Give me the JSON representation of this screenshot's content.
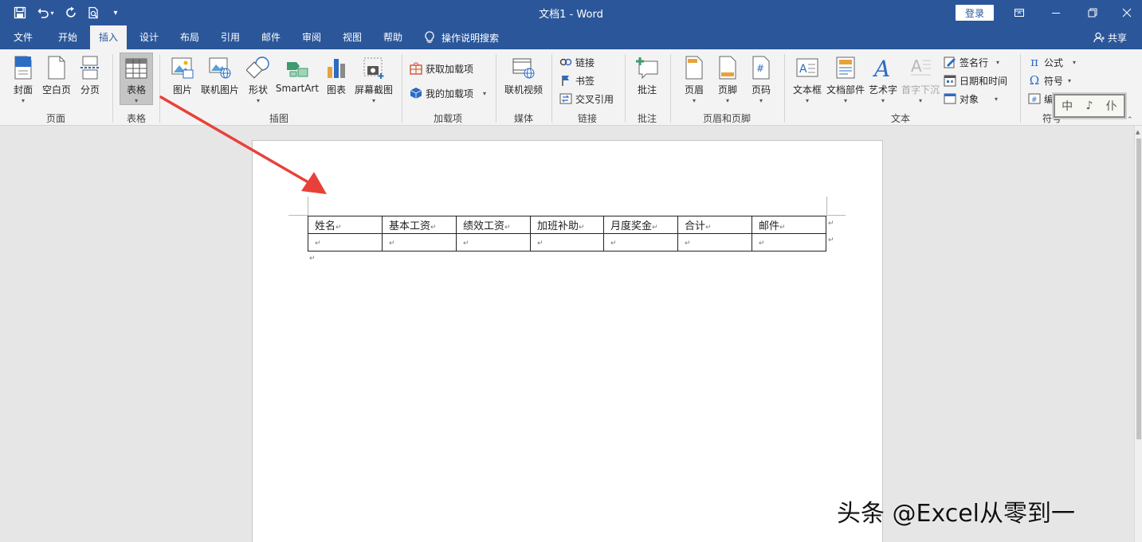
{
  "app": {
    "doc_title": "文档1",
    "separator": " - ",
    "app_name": "Word",
    "login_label": "登录"
  },
  "quick_access": {
    "save_icon": "save-icon",
    "undo_icon": "undo-icon",
    "redo_icon": "redo-icon",
    "print_preview_icon": "print-preview-icon",
    "customize_icon": "customize-icon"
  },
  "tabs": [
    "文件",
    "开始",
    "插入",
    "设计",
    "布局",
    "引用",
    "邮件",
    "审阅",
    "视图",
    "帮助"
  ],
  "active_tab": "插入",
  "tell_me": "操作说明搜索",
  "share_label": "共享",
  "ribbon": {
    "groups": {
      "pages": "页面",
      "tables": "表格",
      "illustrations": "插图",
      "addins": "加载项",
      "media": "媒体",
      "links": "链接",
      "comments": "批注",
      "header_footer": "页眉和页脚",
      "text": "文本",
      "symbols": "符号"
    },
    "buttons": {
      "cover": "封面",
      "blank_page": "空白页",
      "page_break": "分页",
      "table": "表格",
      "pictures": "图片",
      "online_pictures": "联机图片",
      "shapes": "形状",
      "smartart": "SmartArt",
      "chart": "图表",
      "screenshot": "屏幕截图",
      "get_addins": "获取加载项",
      "my_addins": "我的加载项",
      "online_video": "联机视频",
      "link": "链接",
      "bookmark": "书签",
      "cross_reference": "交叉引用",
      "comment": "批注",
      "header": "页眉",
      "footer": "页脚",
      "page_number": "页码",
      "text_box": "文本框",
      "quick_parts": "文档部件",
      "wordart": "艺术字",
      "drop_cap": "首字下沉",
      "signature_line": "签名行",
      "date_time": "日期和时间",
      "object": "对象",
      "equation": "公式",
      "symbol": "符号",
      "number": "编号"
    }
  },
  "document": {
    "table_headers": [
      "姓名",
      "基本工资",
      "绩效工资",
      "加班补助",
      "月度奖金",
      "合计",
      "邮件"
    ],
    "row2": [
      "",
      "",
      "",
      "",
      "",
      "",
      ""
    ],
    "paragraph_mark": "↵"
  },
  "overlays": {
    "watermark": "头条 @Excel从零到一",
    "ime_chars": [
      "中",
      "♪",
      "仆"
    ]
  },
  "colors": {
    "accent": "#2b579a",
    "ribbon_bg": "#f3f3f3",
    "arrow": "#e8413a"
  }
}
